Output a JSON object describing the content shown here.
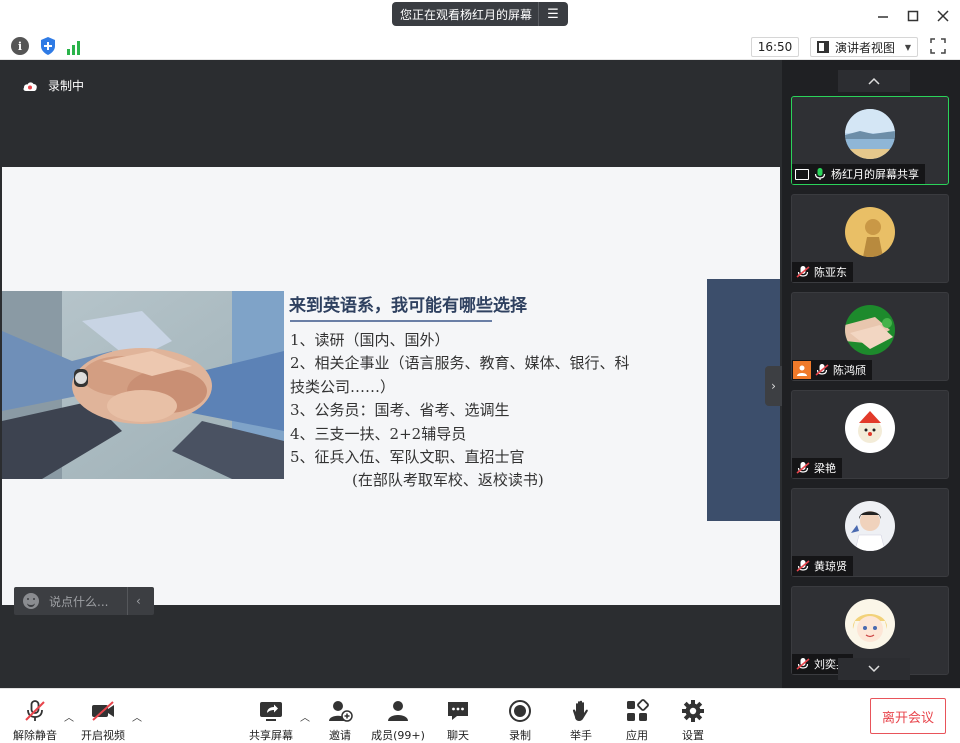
{
  "titlebar": {
    "sharing_notice": "您正在观看杨红月的屏幕"
  },
  "toolbar": {
    "time": "16:50",
    "view_mode": "演讲者视图"
  },
  "stage": {
    "recording_label": "录制中",
    "chat_placeholder": "说点什么..."
  },
  "slide": {
    "title": "来到英语系，我可能有哪些选择",
    "bullets": [
      "1、读研（国内、国外）",
      "2、相关企事业（语言服务、教育、媒体、银行、科",
      "技类公司……）",
      "3、公务员：国考、省考、选调生",
      "4、三支一扶、2+2辅导员",
      "5、征兵入伍、军队文职、直招士官",
      "(在部队考取军校、返校读书)"
    ]
  },
  "participants": [
    {
      "name": "杨红月的屏幕共享",
      "muted": false,
      "sharing": true
    },
    {
      "name": "陈亚东",
      "muted": true
    },
    {
      "name": "陈鸿颀",
      "muted": true
    },
    {
      "name": "梁艳",
      "muted": true
    },
    {
      "name": "黄琼贤",
      "muted": true
    },
    {
      "name": "刘奕兵",
      "muted": true
    }
  ],
  "bottombar": {
    "unmute": "解除静音",
    "start_video": "开启视频",
    "share_screen": "共享屏幕",
    "invite": "邀请",
    "members": "成员(99+)",
    "chat": "聊天",
    "record": "录制",
    "raise_hand": "举手",
    "apps": "应用",
    "settings": "设置",
    "leave": "离开会议"
  },
  "colors": {
    "accent_green": "#2bd35a",
    "leave_red": "#e8454c",
    "slide_title": "#2f4160"
  }
}
